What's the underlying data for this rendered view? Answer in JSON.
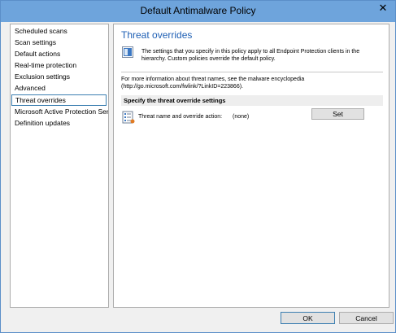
{
  "window": {
    "title": "Default Antimalware Policy",
    "close_glyph": "✕"
  },
  "nav": {
    "items": [
      {
        "label": "Scheduled scans",
        "selected": false
      },
      {
        "label": "Scan settings",
        "selected": false
      },
      {
        "label": "Default actions",
        "selected": false
      },
      {
        "label": "Real-time protection",
        "selected": false
      },
      {
        "label": "Exclusion settings",
        "selected": false
      },
      {
        "label": "Advanced",
        "selected": false
      },
      {
        "label": "Threat overrides",
        "selected": true
      },
      {
        "label": "Microsoft Active Protection Service",
        "selected": false
      },
      {
        "label": "Definition updates",
        "selected": false
      }
    ]
  },
  "content": {
    "title": "Threat overrides",
    "info_text": "The settings that you specify in this policy apply to all Endpoint Protection clients in the hierarchy. Custom policies override the default policy.",
    "more_info_text": "For more information about threat names, see the malware encyclopedia (http://go.microsoft.com/fwlink/?LinkID=223866).",
    "group_header": "Specify the threat override settings",
    "override_label": "Threat name and override action:",
    "override_value": "(none)",
    "set_button": "Set"
  },
  "footer": {
    "ok_label": "OK",
    "cancel_label": "Cancel"
  },
  "colors": {
    "titlebar": "#6ea4dc",
    "heading": "#1e5fb4",
    "selection_border": "#3c7fb1"
  }
}
